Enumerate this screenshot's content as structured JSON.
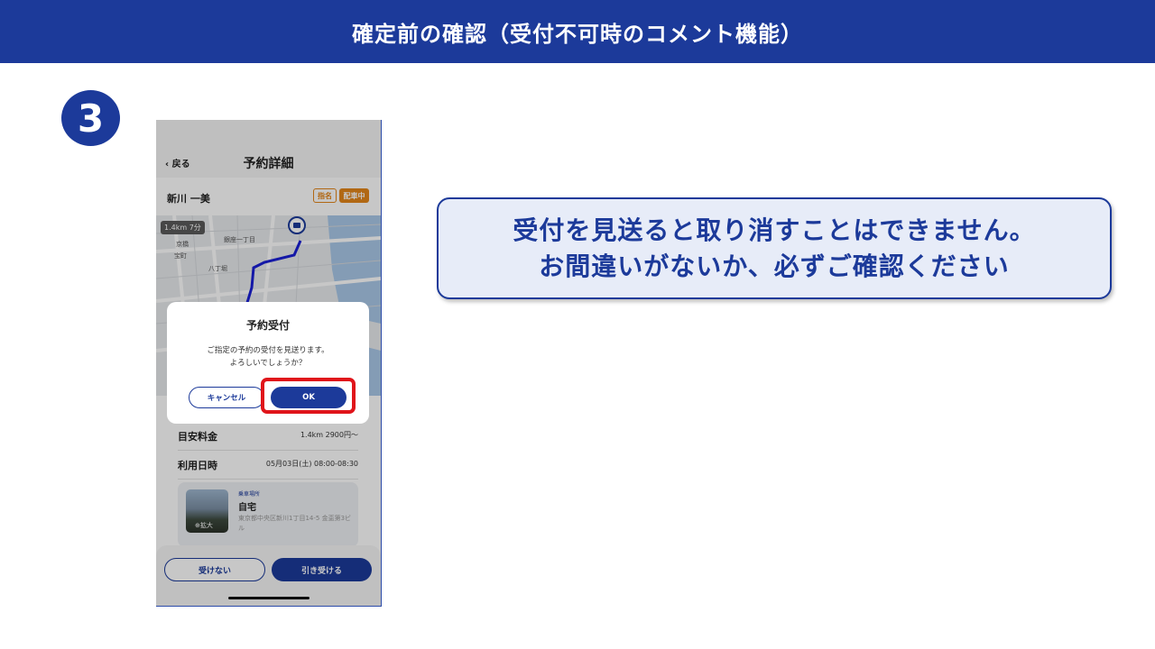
{
  "slide": {
    "title": "確定前の確認（受付不可時のコメント機能）",
    "step_number": "3",
    "callout": {
      "line1": "受付を見送ると取り消すことはできません。",
      "line2": "お間違いがないか、必ずご確認ください"
    },
    "highlight_color": "#e0141a"
  },
  "phone": {
    "nav": {
      "back_label": "戻る",
      "title": "予約詳細"
    },
    "customer": {
      "name": "新川 一美",
      "tags": [
        "指名",
        "配車中"
      ]
    },
    "map": {
      "distance_chip": "1.4km 7分",
      "labels": [
        "京橋",
        "宝町",
        "八丁堀",
        "銀座一丁目"
      ]
    },
    "details": {
      "rows": [
        {
          "label": "目安料金",
          "value": "1.4km 2900円〜"
        },
        {
          "label": "利用日時",
          "value": "05月03日(土) 08:00-08:30"
        }
      ],
      "place": {
        "caption": "乗車場所",
        "name": "自宅",
        "address": "東京都中央区新川1丁目14-5 金盃第3ビル",
        "zoom_label": "拡大"
      }
    },
    "bottom": {
      "decline_label": "受けない",
      "accept_label": "引き受ける"
    },
    "dialog": {
      "title": "予約受付",
      "message_line1": "ご指定の予約の受付を見送ります。",
      "message_line2": "よろしいでしょうか？",
      "cancel_label": "キャンセル",
      "ok_label": "OK"
    }
  },
  "colors": {
    "brand": "#1c3a9a",
    "accent_orange": "#e3861a"
  }
}
